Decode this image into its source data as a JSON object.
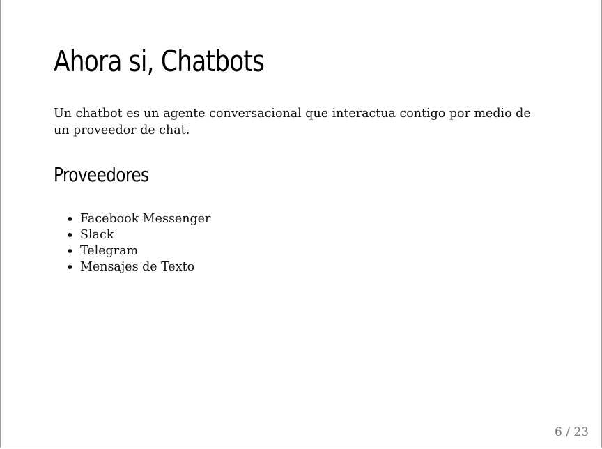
{
  "slide": {
    "title": "Ahora si, Chatbots",
    "intro": "Un chatbot es un agente conversacional que interactua contigo por medio de un proveedor de chat.",
    "section_heading": "Proveedores",
    "providers": [
      "Facebook Messenger",
      "Slack",
      "Telegram",
      "Mensajes de Texto"
    ],
    "page_counter": "6 / 23"
  }
}
